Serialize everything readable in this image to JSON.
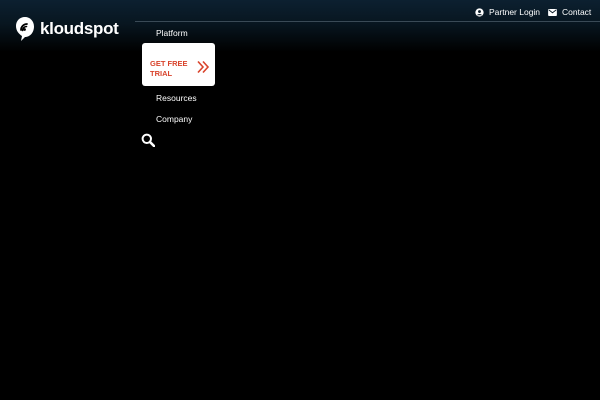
{
  "brand": {
    "name": "kloudspot",
    "logo_icon": "kloudspot-logo-icon"
  },
  "utility_nav": {
    "partner_login": {
      "label": "Partner Login",
      "icon": "user-circle-icon"
    },
    "contact": {
      "label": "Contact",
      "icon": "envelope-icon"
    }
  },
  "main_nav": {
    "items": [
      {
        "label": "Platform"
      },
      {
        "label": "Resources"
      },
      {
        "label": "Company"
      }
    ],
    "cta": {
      "label": "GET FREE TRIAL",
      "icon": "double-chevron-right-icon",
      "color": "#d9432b"
    },
    "search": {
      "icon": "search-icon"
    }
  },
  "colors": {
    "background": "#000000",
    "header_top": "#0c2030",
    "cta_background": "#ffffff",
    "accent": "#d9432b"
  }
}
